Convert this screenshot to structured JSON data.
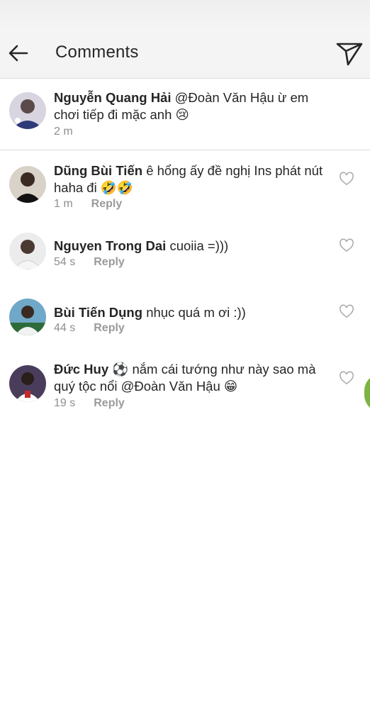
{
  "header": {
    "title": "Comments",
    "back_icon": "arrow-left-icon",
    "send_icon": "send-icon"
  },
  "caption": {
    "username": "Nguyễn Quang Hải",
    "text": "@Đoàn Văn Hậu ừ em chơi tiếp đi mặc anh 😢",
    "time": "2 m"
  },
  "comments": [
    {
      "username": "Dũng Bùi Tiến",
      "text": "ê hổng ấy đề nghị Ins phát nút haha đi 🤣🤣",
      "time": "1 m",
      "reply": "Reply"
    },
    {
      "username": "Nguyen Trong Dai",
      "text": "cuoiia =)))",
      "time": "54 s",
      "reply": "Reply"
    },
    {
      "username": "Bùi Tiến Dụng",
      "text": "nhục quá m ơi :))",
      "time": "44 s",
      "reply": "Reply"
    },
    {
      "username": "Đức Huy ⚽",
      "text": "nắm cái tướng như này sao mà quý tộc nổi @Đoàn Văn Hậu 😁",
      "time": "19 s",
      "reply": "Reply"
    }
  ],
  "colors": {
    "background": "#ffffff",
    "text": "#262626",
    "secondary": "#8e8e8e",
    "header_bg": "#f3f3f3"
  }
}
